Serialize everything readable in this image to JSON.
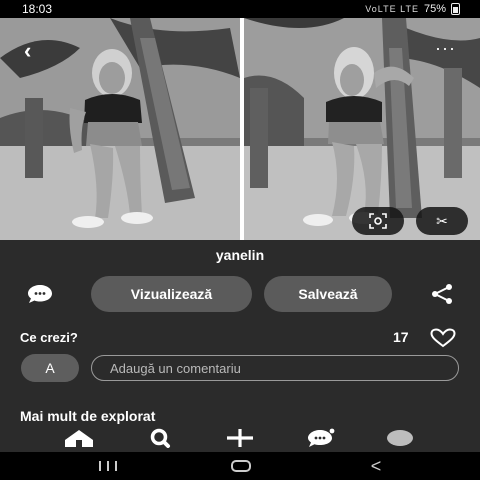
{
  "status_bar": {
    "time": "18:03",
    "network": "VoLTE LTE",
    "battery": "75%"
  },
  "pin": {
    "title": "yanelin"
  },
  "actions": {
    "view_label": "Vizualizează",
    "save_label": "Salvează"
  },
  "comments": {
    "heading": "Ce crezi?",
    "like_count": "17",
    "avatar_initial": "A",
    "input_placeholder": "Adaugă un comentariu"
  },
  "more": {
    "heading": "Mai mult de explorat"
  },
  "icons": {
    "back": "back-arrow-icon",
    "more": "more-dots-icon",
    "lens": "visual-search-icon",
    "crop": "scissors-icon",
    "comment": "comment-bubble-icon",
    "share": "share-icon",
    "heart": "heart-icon",
    "home": "home-icon",
    "search": "search-icon",
    "create": "plus-icon",
    "messages": "messages-icon",
    "profile": "profile-icon"
  },
  "colors": {
    "surface": "#2b2b2b",
    "button": "#5b5b5b",
    "text": "#ffffff"
  }
}
